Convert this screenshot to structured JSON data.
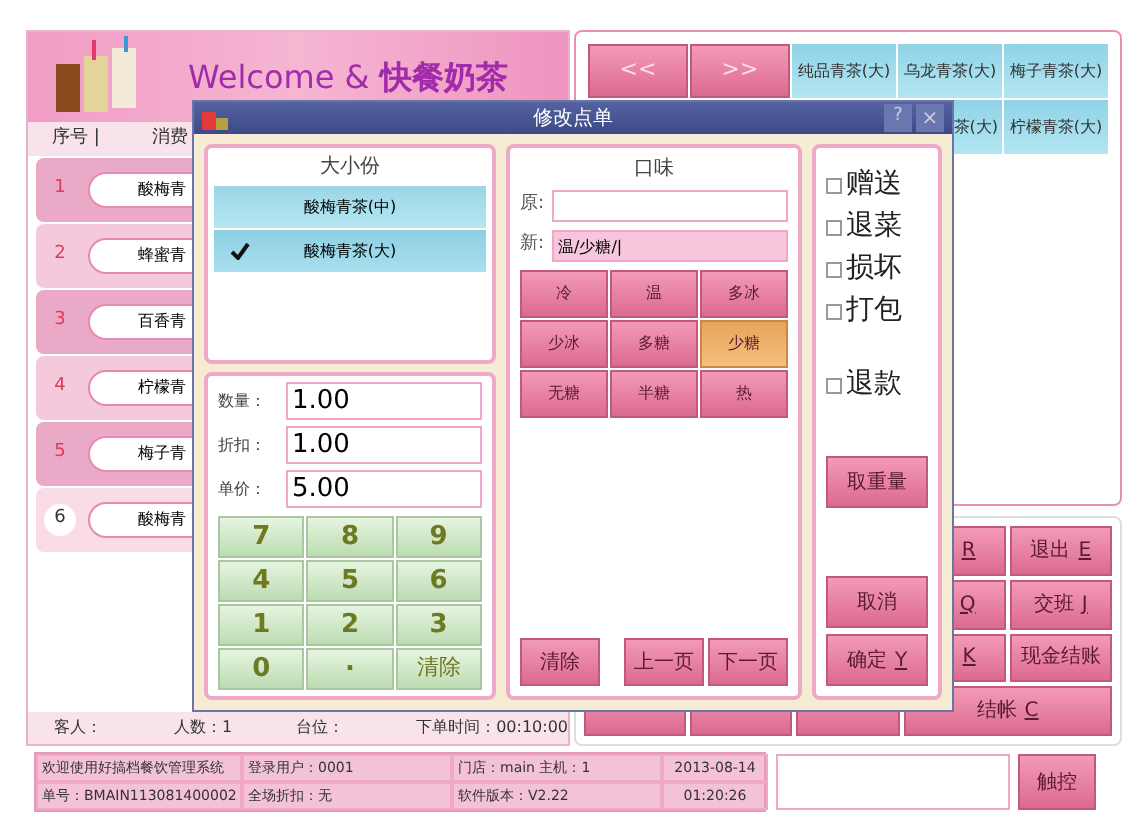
{
  "header": {
    "title": "Welcome & **快餐奶茶**"
  },
  "order_list": {
    "columns": [
      "序号 |",
      "消费"
    ],
    "rows": [
      {
        "number": "1",
        "name": "酸梅青",
        "selected": false
      },
      {
        "number": "2",
        "name": "蜂蜜青",
        "selected": false
      },
      {
        "number": "3",
        "name": "百香青",
        "selected": false
      },
      {
        "number": "4",
        "name": "柠檬青",
        "selected": false
      },
      {
        "number": "5",
        "name": "梅子青",
        "selected": false
      },
      {
        "number": "6",
        "name": "酸梅青",
        "selected": true
      }
    ]
  },
  "info_line": [
    "客人：",
    "人数：1",
    "台位：",
    "下单时间：00:10:00"
  ],
  "products": {
    "nav": [
      "<<",
      ">>"
    ],
    "items": [
      {
        "label": "纯品青茶(大)"
      },
      {
        "label": "乌龙青茶(大)"
      },
      {
        "label": "梅子青茶(大)"
      },
      {
        "label": "茶(大)"
      },
      {
        "label": "柠檬青茶(大)"
      }
    ]
  },
  "functions": [
    {
      "key": "R"
    },
    {
      "label": "退出",
      "key": "E"
    },
    {
      "key": "Q"
    },
    {
      "label": "交班",
      "key": "J"
    },
    {
      "key": "K"
    },
    {
      "label": "现金结账"
    }
  ],
  "function_bottom": {
    "label": "结帐",
    "key": "C"
  },
  "status_bar": [
    [
      "欢迎使用好搞档餐饮管理系统",
      "登录用户：0001",
      "门店：main  主机：1",
      "2013-08-14"
    ],
    [
      "单号：BMAIN113081400002",
      "全场折扣：无",
      "软件版本：V2.22",
      "01:20:26"
    ]
  ],
  "touch_button": "触控",
  "dialog": {
    "title": "修改点单",
    "help": "?",
    "close": "×",
    "sizes": {
      "title": "大小份",
      "items": [
        {
          "label": "酸梅青茶(中)",
          "selected": false
        },
        {
          "label": "酸梅青茶(大)",
          "selected": true
        }
      ]
    },
    "fields": [
      {
        "label": "数量：",
        "value": "1.00"
      },
      {
        "label": "折扣：",
        "value": "1.00"
      },
      {
        "label": "单价：",
        "value": "5.00"
      }
    ],
    "keypad": [
      {
        "kind": "digit",
        "label": "7"
      },
      {
        "kind": "digit",
        "label": "8"
      },
      {
        "kind": "digit",
        "label": "9"
      },
      {
        "kind": "digit",
        "label": "4"
      },
      {
        "kind": "digit",
        "label": "5"
      },
      {
        "kind": "digit",
        "label": "6"
      },
      {
        "kind": "digit",
        "label": "1"
      },
      {
        "kind": "digit",
        "label": "2"
      },
      {
        "kind": "digit",
        "label": "3"
      },
      {
        "kind": "digit",
        "label": "0"
      },
      {
        "kind": "point",
        "label": "."
      },
      {
        "kind": "action",
        "label": "清除"
      }
    ],
    "taste": {
      "title": "口味",
      "original_label": "原:",
      "new_label": "新:",
      "new_value": "温/少糖/|",
      "options": [
        {
          "label": "冷",
          "selected": false
        },
        {
          "label": "温",
          "selected": false
        },
        {
          "label": "多冰",
          "selected": false
        },
        {
          "label": "少冰",
          "selected": false
        },
        {
          "label": "多糖",
          "selected": false
        },
        {
          "label": "少糖",
          "selected": true
        },
        {
          "label": "无糖",
          "selected": false
        },
        {
          "label": "半糖",
          "selected": false
        },
        {
          "label": "热",
          "selected": false
        }
      ],
      "clear": "清除",
      "prev": "上一页",
      "next": "下一页"
    },
    "options": [
      {
        "label": "赠送",
        "checked": false
      },
      {
        "label": "退菜",
        "checked": false
      },
      {
        "label": "损坏",
        "checked": false
      },
      {
        "label": "打包",
        "checked": false
      },
      {
        "label": "退款",
        "checked": false
      }
    ],
    "weigh": "取重量",
    "cancel": "取消",
    "ok": {
      "label": "确定",
      "key": "Y"
    }
  }
}
